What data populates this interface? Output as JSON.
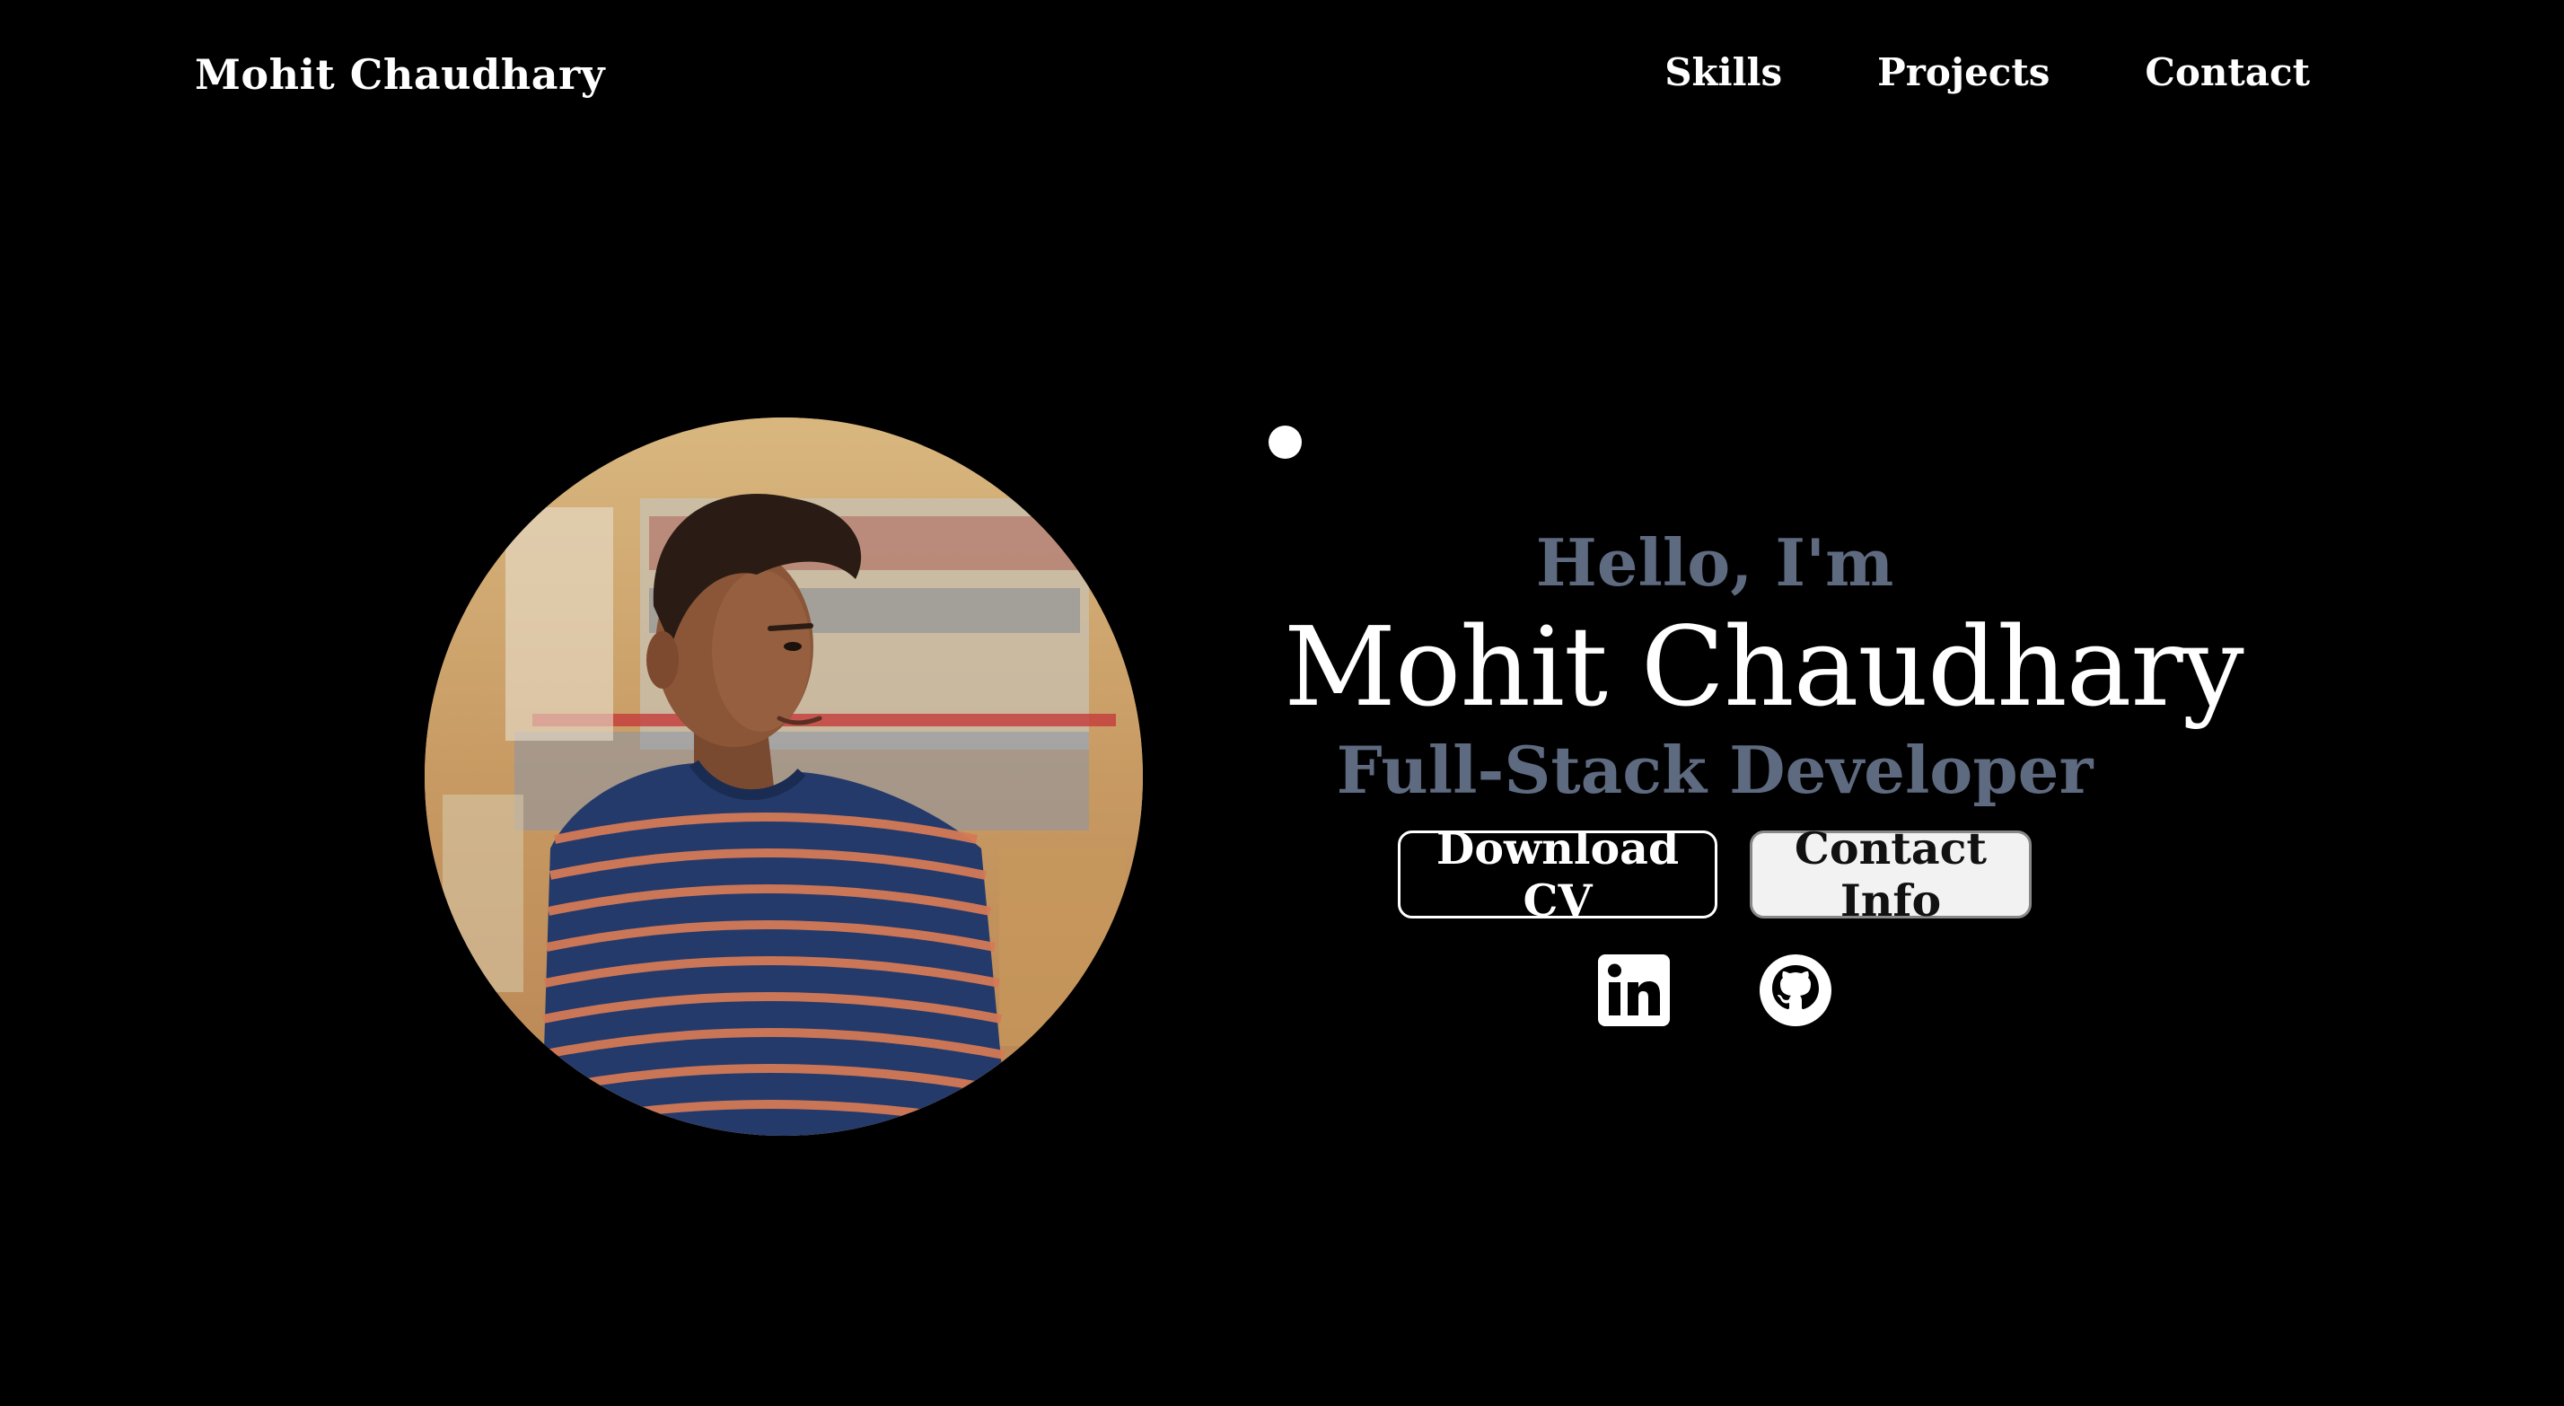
{
  "nav": {
    "brand": "Mohit Chaudhary",
    "links": [
      {
        "label": "Skills"
      },
      {
        "label": "Projects"
      },
      {
        "label": "Contact"
      }
    ]
  },
  "hero": {
    "greeting": "Hello, I'm",
    "name": "Mohit Chaudhary",
    "role": "Full-Stack Developer",
    "buttons": {
      "download_cv": "Download CV",
      "contact_info": "Contact Info"
    },
    "socials": [
      "linkedin-icon",
      "github-icon"
    ],
    "profile_photo": "profile-photo"
  },
  "colors": {
    "background": "#000000",
    "text": "#ffffff",
    "muted": "#5e6a7f",
    "button_filled": "#f2f2f2"
  }
}
